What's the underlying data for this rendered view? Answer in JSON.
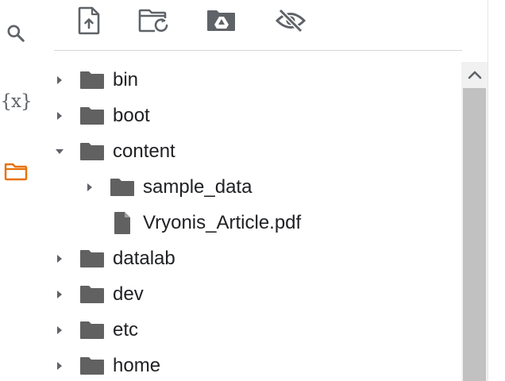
{
  "sidebar": {
    "icons": [
      "search-icon",
      "variables-icon",
      "folder-icon"
    ],
    "variables_glyph": "{x}",
    "active_color": "#e8710a",
    "icon_color": "#5f6368"
  },
  "toolbar": {
    "icons": [
      "upload-file-icon",
      "refresh-folder-icon",
      "mount-drive-icon",
      "hide-files-icon"
    ]
  },
  "tree": {
    "items": [
      {
        "label": "bin",
        "type": "folder",
        "expanded": false,
        "depth": 0
      },
      {
        "label": "boot",
        "type": "folder",
        "expanded": false,
        "depth": 0
      },
      {
        "label": "content",
        "type": "folder",
        "expanded": true,
        "depth": 0
      },
      {
        "label": "sample_data",
        "type": "folder",
        "expanded": false,
        "depth": 1
      },
      {
        "label": "Vryonis_Article.pdf",
        "type": "file",
        "depth": 1
      },
      {
        "label": "datalab",
        "type": "folder",
        "expanded": false,
        "depth": 0
      },
      {
        "label": "dev",
        "type": "folder",
        "expanded": false,
        "depth": 0
      },
      {
        "label": "etc",
        "type": "folder",
        "expanded": false,
        "depth": 0
      },
      {
        "label": "home",
        "type": "folder",
        "expanded": false,
        "depth": 0
      }
    ]
  },
  "colors": {
    "text": "#202124",
    "icon": "#616161",
    "scroll_track": "#f1f1f1",
    "scroll_thumb": "#c1c1c1"
  }
}
